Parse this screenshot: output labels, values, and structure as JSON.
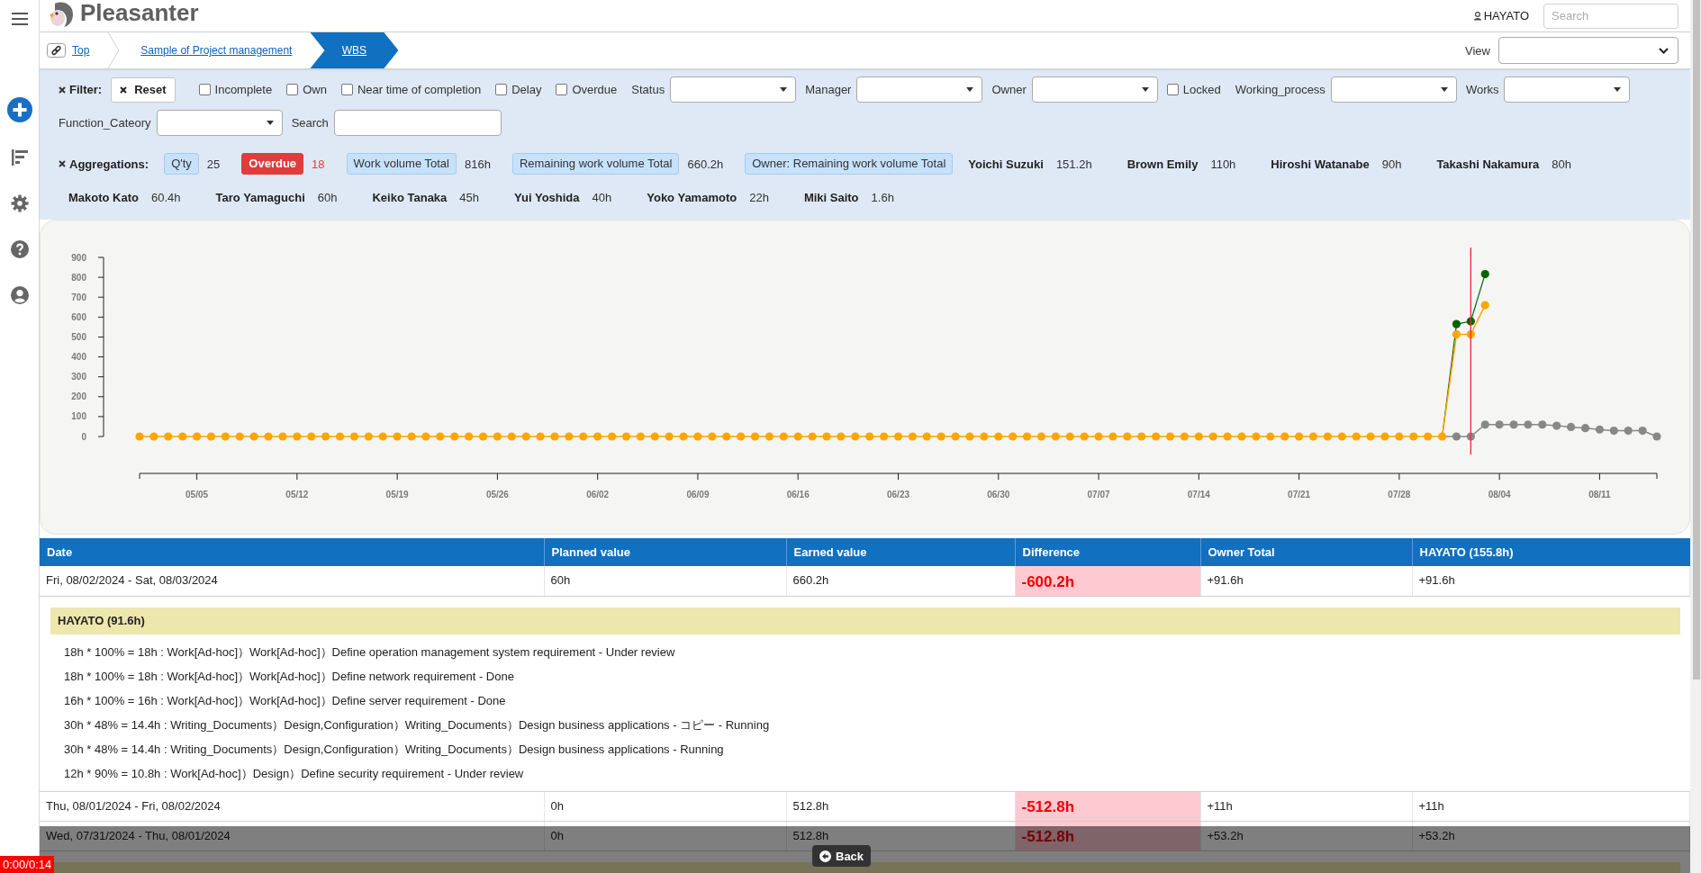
{
  "header": {
    "logo": "Pleasanter",
    "user": "HAYATO",
    "search": {
      "placeholder": "Search"
    }
  },
  "breadcrumb": {
    "items": [
      {
        "label": "Top",
        "selected": false
      },
      {
        "label": "Sample of Project management",
        "selected": false
      },
      {
        "label": "WBS",
        "selected": true
      }
    ],
    "view": {
      "label": "View"
    }
  },
  "filters": {
    "title": "Filter:",
    "reset_button": "Reset",
    "controls": [
      {
        "kind": "checkbox",
        "label": "Incomplete",
        "checked": false
      },
      {
        "kind": "checkbox",
        "label": "Own",
        "checked": false
      },
      {
        "kind": "checkbox",
        "label": "Near time of completion",
        "checked": false
      },
      {
        "kind": "checkbox",
        "label": "Delay",
        "checked": false
      },
      {
        "kind": "checkbox",
        "label": "Overdue",
        "checked": false
      },
      {
        "kind": "select",
        "label": "Status"
      },
      {
        "kind": "select",
        "label": "Manager"
      },
      {
        "kind": "select",
        "label": "Owner"
      },
      {
        "kind": "checkbox",
        "label": "Locked",
        "checked": false
      },
      {
        "kind": "select",
        "label": "Working_process"
      },
      {
        "kind": "select",
        "label": "Works"
      },
      {
        "kind": "select",
        "label": "Function_Cateory"
      },
      {
        "kind": "text",
        "label": "Search"
      }
    ]
  },
  "aggregations": {
    "title": "Aggregations:",
    "items": [
      {
        "kind": "badge",
        "label": "Q'ty",
        "value": "25"
      },
      {
        "kind": "alert",
        "label": "Overdue",
        "value": "18"
      },
      {
        "kind": "badge",
        "label": "Work volume Total",
        "value": "816h"
      },
      {
        "kind": "badge",
        "label": "Remaining work volume Total",
        "value": "660.2h"
      },
      {
        "kind": "badge",
        "label": "Owner: Remaining work volume Total"
      },
      {
        "kind": "owner",
        "label": "Yoichi Suzuki",
        "value": "151.2h"
      },
      {
        "kind": "owner",
        "label": "Brown Emily",
        "value": "110h"
      },
      {
        "kind": "owner",
        "label": "Hiroshi Watanabe",
        "value": "90h"
      },
      {
        "kind": "owner",
        "label": "Takashi Nakamura",
        "value": "80h"
      },
      {
        "kind": "owner",
        "label": "Makoto Kato",
        "value": "60.4h"
      },
      {
        "kind": "owner",
        "label": "Taro Yamaguchi",
        "value": "60h"
      },
      {
        "kind": "owner",
        "label": "Keiko Tanaka",
        "value": "45h"
      },
      {
        "kind": "owner",
        "label": "Yui Yoshida",
        "value": "40h"
      },
      {
        "kind": "owner",
        "label": "Yoko Yamamoto",
        "value": "22h"
      },
      {
        "kind": "owner",
        "label": "Miki Saito",
        "value": "1.6h"
      }
    ]
  },
  "chart": {
    "chart_data": {
      "type": "line",
      "ylim": [
        0,
        900
      ],
      "yticks": [
        0,
        100,
        200,
        300,
        400,
        500,
        600,
        700,
        800,
        900
      ],
      "categories": [
        null,
        null,
        null,
        null,
        "05/05",
        null,
        null,
        null,
        null,
        null,
        null,
        "05/12",
        null,
        null,
        null,
        null,
        null,
        null,
        "05/19",
        null,
        null,
        null,
        null,
        null,
        null,
        "05/26",
        null,
        null,
        null,
        null,
        null,
        null,
        "06/02",
        null,
        null,
        null,
        null,
        null,
        null,
        "06/09",
        null,
        null,
        null,
        null,
        null,
        null,
        "06/16",
        null,
        null,
        null,
        null,
        null,
        null,
        "06/23",
        null,
        null,
        null,
        null,
        null,
        null,
        "06/30",
        null,
        null,
        null,
        null,
        null,
        null,
        "07/07",
        null,
        null,
        null,
        null,
        null,
        null,
        "07/14",
        null,
        null,
        null,
        null,
        null,
        null,
        "07/21",
        null,
        null,
        null,
        null,
        null,
        null,
        "07/28",
        null,
        null,
        null,
        null,
        null,
        null,
        "08/04",
        null,
        null,
        null,
        null,
        null,
        null,
        "08/11",
        null,
        null,
        null,
        null
      ],
      "series": [
        {
          "color": "#888888",
          "marker": "circle",
          "values": [
            null,
            null,
            null,
            null,
            null,
            null,
            null,
            null,
            null,
            null,
            null,
            null,
            null,
            null,
            null,
            null,
            null,
            null,
            null,
            null,
            null,
            null,
            null,
            null,
            null,
            null,
            null,
            null,
            null,
            null,
            null,
            null,
            null,
            null,
            null,
            null,
            null,
            null,
            null,
            null,
            null,
            null,
            null,
            null,
            null,
            null,
            null,
            null,
            null,
            null,
            null,
            null,
            null,
            null,
            null,
            null,
            null,
            null,
            null,
            null,
            null,
            null,
            null,
            null,
            null,
            null,
            null,
            null,
            null,
            null,
            null,
            null,
            null,
            null,
            null,
            null,
            null,
            null,
            null,
            null,
            null,
            null,
            null,
            null,
            null,
            null,
            null,
            null,
            null,
            null,
            null,
            0,
            0,
            0,
            60,
            60,
            60,
            60,
            60,
            54,
            48,
            42,
            35,
            29,
            29,
            29,
            0
          ]
        },
        {
          "color": "#006400",
          "marker": "circle",
          "values": [
            null,
            null,
            null,
            null,
            null,
            null,
            null,
            null,
            null,
            null,
            null,
            null,
            null,
            null,
            null,
            null,
            null,
            null,
            null,
            null,
            null,
            null,
            null,
            null,
            null,
            null,
            null,
            null,
            null,
            null,
            null,
            null,
            null,
            null,
            null,
            null,
            null,
            null,
            null,
            null,
            null,
            null,
            null,
            null,
            null,
            null,
            null,
            null,
            null,
            null,
            null,
            null,
            null,
            null,
            null,
            null,
            null,
            null,
            null,
            null,
            null,
            null,
            null,
            null,
            null,
            null,
            null,
            null,
            null,
            null,
            null,
            null,
            null,
            null,
            null,
            null,
            null,
            null,
            null,
            null,
            null,
            null,
            null,
            null,
            null,
            null,
            null,
            null,
            null,
            null,
            null,
            0,
            565,
            579,
            816,
            null,
            null,
            null,
            null,
            null,
            null,
            null,
            null,
            null,
            null,
            null,
            null
          ]
        },
        {
          "color": "#ffa500",
          "marker": "circle",
          "values": [
            0,
            0,
            0,
            0,
            0,
            0,
            0,
            0,
            0,
            0,
            0,
            0,
            0,
            0,
            0,
            0,
            0,
            0,
            0,
            0,
            0,
            0,
            0,
            0,
            0,
            0,
            0,
            0,
            0,
            0,
            0,
            0,
            0,
            0,
            0,
            0,
            0,
            0,
            0,
            0,
            0,
            0,
            0,
            0,
            0,
            0,
            0,
            0,
            0,
            0,
            0,
            0,
            0,
            0,
            0,
            0,
            0,
            0,
            0,
            0,
            0,
            0,
            0,
            0,
            0,
            0,
            0,
            0,
            0,
            0,
            0,
            0,
            0,
            0,
            0,
            0,
            0,
            0,
            0,
            0,
            0,
            0,
            0,
            0,
            0,
            0,
            0,
            0,
            0,
            0,
            0,
            0,
            513,
            513,
            660,
            null,
            null,
            null,
            null,
            null,
            null,
            null,
            null,
            null,
            null,
            null,
            null
          ]
        }
      ]
    }
  },
  "table": {
    "columns": [
      "Date",
      "Planned value",
      "Earned value",
      "Difference",
      "Owner Total",
      "HAYATO (155.8h)"
    ],
    "rows": [
      {
        "cells": [
          "Fri, 08/02/2024 - Sat, 08/03/2024",
          "60h",
          "660.2h",
          "-600.2h",
          "+91.6h",
          "+91.6h"
        ],
        "expanded": true,
        "detail": {
          "owner": "HAYATO (91.6h)",
          "items": [
            "18h * 100% = 18h : Work[Ad-hoc]）Work[Ad-hoc]）Define operation management system requirement - Under review",
            "18h * 100% = 18h : Work[Ad-hoc]）Work[Ad-hoc]）Define network requirement - Done",
            "16h * 100% = 16h : Work[Ad-hoc]）Work[Ad-hoc]）Define server requirement - Done",
            "30h * 48% = 14.4h : Writing_Documents）Design,Configuration）Writing_Documents）Design business applications - コピー - Running",
            "30h * 48% = 14.4h : Writing_Documents）Design,Configuration）Writing_Documents）Design business applications - Running",
            "12h * 90% = 10.8h : Work[Ad-hoc]）Design）Define security requirement - Under review"
          ]
        }
      },
      {
        "cells": [
          "Thu, 08/01/2024 - Fri, 08/02/2024",
          "0h",
          "512.8h",
          "-512.8h",
          "+11h",
          "+11h"
        ],
        "expanded": false
      },
      {
        "cells": [
          "Wed, 07/31/2024 - Thu, 08/01/2024",
          "0h",
          "512.8h",
          "-512.8h",
          "+53.2h",
          "+53.2h"
        ],
        "expanded": true
      }
    ]
  },
  "player": {
    "time": "0:00/0:14",
    "back_button": "Back"
  }
}
